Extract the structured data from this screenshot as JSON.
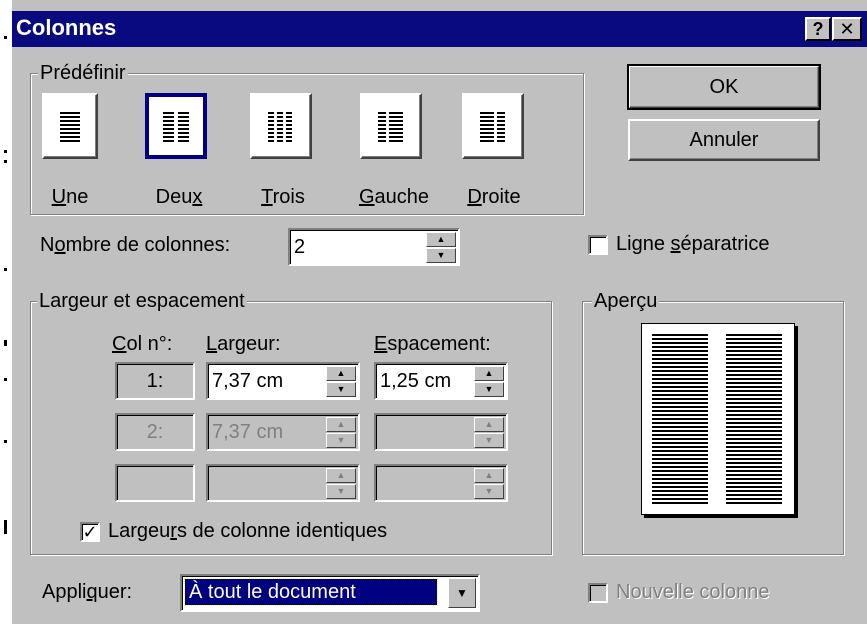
{
  "window": {
    "title": "Colonnes",
    "help_label": "?",
    "close_label": "✕"
  },
  "presets": {
    "group_label": "Prédéfinir",
    "items": [
      {
        "label_pre": "",
        "label_u": "U",
        "label_post": "ne"
      },
      {
        "label_pre": "Deu",
        "label_u": "x",
        "label_post": ""
      },
      {
        "label_pre": "",
        "label_u": "T",
        "label_post": "rois"
      },
      {
        "label_pre": "",
        "label_u": "G",
        "label_post": "auche"
      },
      {
        "label_pre": "",
        "label_u": "D",
        "label_post": "roite"
      }
    ],
    "selected": "Deux"
  },
  "buttons": {
    "ok": "OK",
    "cancel": "Annuler"
  },
  "column_count": {
    "label_pre": "N",
    "label_u": "o",
    "label_post": "mbre de colonnes:",
    "value": "2"
  },
  "separator": {
    "label_pre": "Ligne ",
    "label_u": "s",
    "label_post": "éparatrice",
    "checked": false
  },
  "width_spacing": {
    "group_label": "Largeur et espacement",
    "col_header_u": "C",
    "col_header_post": "ol n°:",
    "width_header_u": "L",
    "width_header_post": "argeur:",
    "spacing_header_u": "E",
    "spacing_header_post": "spacement:",
    "rows": [
      {
        "col": "1:",
        "width": "7,37 cm",
        "spacing": "1,25 cm"
      },
      {
        "col": "2:",
        "width": "7,37 cm",
        "spacing": ""
      },
      {
        "col": "",
        "width": "",
        "spacing": ""
      }
    ],
    "equal_widths": {
      "label_pre": "Largeu",
      "label_u": "r",
      "label_post": "s de colonne identiques",
      "checked": true
    }
  },
  "preview": {
    "group_label": "Aperçu"
  },
  "apply": {
    "label_pre": "Appli",
    "label_u": "q",
    "label_post": "uer:",
    "value": "À tout le document"
  },
  "new_column": {
    "label": "Nouvelle colonne",
    "checked": false,
    "enabled": false
  }
}
